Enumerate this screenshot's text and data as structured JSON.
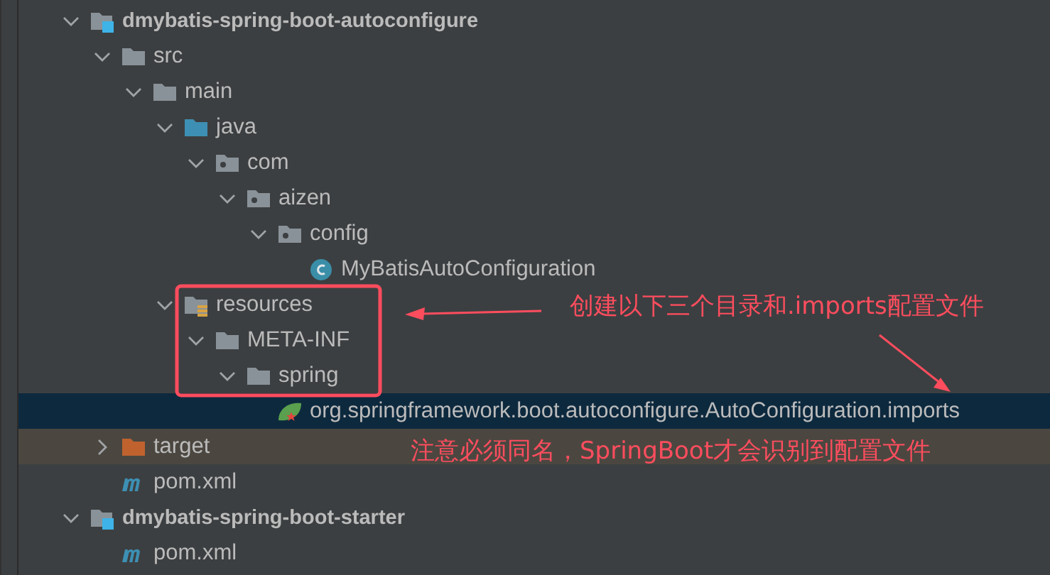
{
  "tree": [
    {
      "name": "dmybatis-spring-boot-autoconfigure",
      "kind": "module",
      "expanded": true,
      "selected": false,
      "children": [
        {
          "name": "src",
          "kind": "folder",
          "expanded": true,
          "selected": false,
          "children": [
            {
              "name": "main",
              "kind": "folder",
              "expanded": true,
              "selected": false,
              "children": [
                {
                  "name": "java",
                  "kind": "source",
                  "expanded": true,
                  "selected": false,
                  "children": [
                    {
                      "name": "com",
                      "kind": "package",
                      "expanded": true,
                      "selected": false,
                      "children": [
                        {
                          "name": "aizen",
                          "kind": "package",
                          "expanded": true,
                          "selected": false,
                          "children": [
                            {
                              "name": "config",
                              "kind": "package",
                              "expanded": true,
                              "selected": false,
                              "children": [
                                {
                                  "name": "MyBatisAutoConfiguration",
                                  "kind": "class",
                                  "selected": false
                                }
                              ]
                            }
                          ]
                        }
                      ]
                    }
                  ]
                },
                {
                  "name": "resources",
                  "kind": "resources",
                  "expanded": true,
                  "selected": false,
                  "children": [
                    {
                      "name": "META-INF",
                      "kind": "folder",
                      "expanded": true,
                      "selected": false,
                      "children": [
                        {
                          "name": "spring",
                          "kind": "folder",
                          "expanded": true,
                          "selected": false,
                          "children": [
                            {
                              "name": "org.springframework.boot.autoconfigure.AutoConfiguration.imports",
                              "kind": "spring",
                              "selected": true
                            }
                          ]
                        }
                      ]
                    }
                  ]
                }
              ]
            }
          ]
        },
        {
          "name": "target",
          "kind": "excluded",
          "expanded": false,
          "selected": false
        },
        {
          "name": "pom.xml",
          "kind": "maven",
          "selected": false
        }
      ]
    },
    {
      "name": "dmybatis-spring-boot-starter",
      "kind": "module",
      "expanded": true,
      "selected": false,
      "children": [
        {
          "name": "pom.xml",
          "kind": "maven",
          "selected": false
        }
      ]
    }
  ],
  "annotations": [
    {
      "kind": "callout",
      "text": "创建以下三个目录和.imports配置文件"
    },
    {
      "kind": "note",
      "text": "注意必须同名，SpringBoot才会识别到配置文件"
    }
  ]
}
